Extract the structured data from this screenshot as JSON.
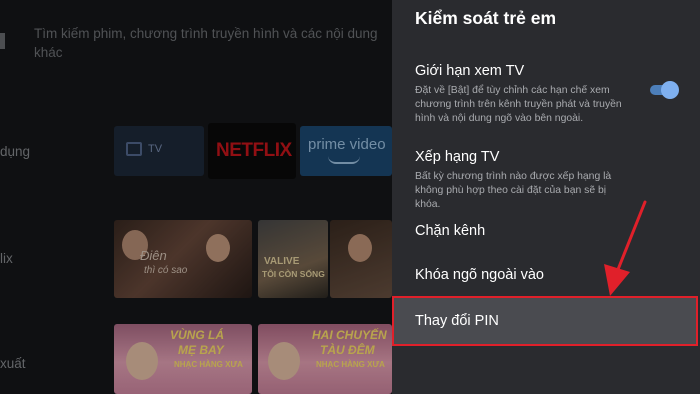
{
  "background": {
    "search_hint": "Tìm kiếm phim, chương trình truyền hình và các nội dung khác",
    "nav": [
      "dụng",
      "lix",
      "xuất"
    ],
    "apps": [
      {
        "name": "tv-app",
        "label": "TV"
      },
      {
        "name": "netflix-app",
        "label": "NETFLIX"
      },
      {
        "name": "prime-video-app",
        "label": "prime video"
      }
    ],
    "posters": [
      {
        "title_line1": "Điên",
        "title_line2": "thì có sao"
      },
      {
        "title_line1": "VALIVE",
        "title_line2": "TÔI CÒN SỐNG"
      },
      {
        "title_line1": "VÙNG LÁ",
        "title_line2": "MẸ BAY",
        "subtitle": "NHẠC HÀNG XƯA"
      },
      {
        "title_line1": "HAI CHUYẾN",
        "title_line2": "TÀU ĐÊM",
        "subtitle": "NHẠC HÀNG XƯA"
      }
    ]
  },
  "panel": {
    "title": "Kiểm soát trẻ em",
    "items": [
      {
        "label": "Giới hạn xem TV",
        "description": "Đặt về [Bật] để tùy chỉnh các hạn chế xem chương trình trên kênh truyền phát và truyền hình và nội dung ngõ vào bên ngoài.",
        "toggle": "on"
      },
      {
        "label": "Xếp hạng TV",
        "description": "Bất kỳ chương trình nào được xếp hạng là không phù hợp theo cài đặt của bạn sẽ bị khóa."
      },
      {
        "label": "Chặn kênh"
      },
      {
        "label": "Khóa ngõ ngoài vào"
      },
      {
        "label": "Thay đổi PIN",
        "highlighted": true
      }
    ]
  },
  "colors": {
    "panel_bg": "#2a2b2f",
    "toggle_on": "#7fb0ef",
    "highlight_border": "#e0202a",
    "arrow": "#e0202a"
  }
}
